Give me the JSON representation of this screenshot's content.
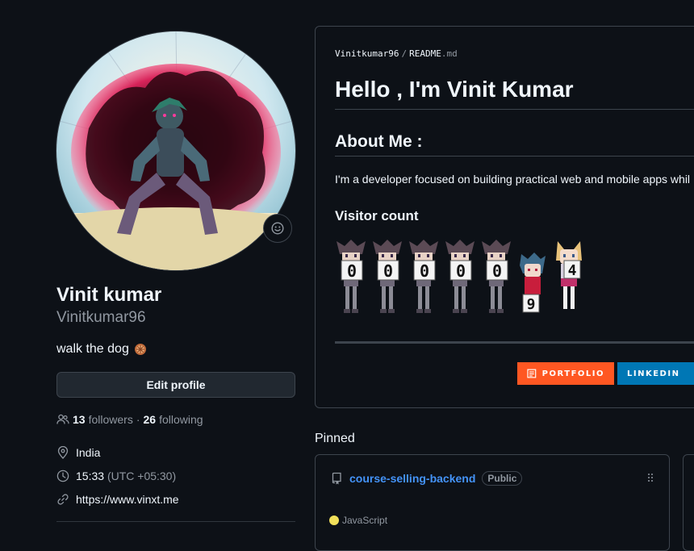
{
  "profile": {
    "display_name": "Vinit kumar",
    "username": "Vinitkumar96",
    "bio": "walk the dog",
    "edit_label": "Edit profile",
    "followers_count": "13",
    "followers_label": "followers",
    "following_count": "26",
    "following_label": "following",
    "separator": "·",
    "location": "India",
    "local_time": "15:33",
    "utc_offset": "(UTC +05:30)",
    "website": "https://www.vinxt.me"
  },
  "readme": {
    "owner": "Vinitkumar96",
    "file_base": "README",
    "file_ext": ".md",
    "heading": "Hello , I'm Vinit Kumar",
    "about_heading": "About Me :",
    "about_text": "I'm a developer focused on building practical web and mobile apps whil",
    "visitor_heading": "Visitor count",
    "visitor_digits": [
      "0",
      "0",
      "0",
      "0",
      "0",
      "9",
      "4"
    ],
    "badges": {
      "portfolio": "PORTFOLIO",
      "linkedin": "LINKEDIN"
    },
    "colors": {
      "portfolio": "#ff5722",
      "linkedin": "#0077b5"
    }
  },
  "pinned": {
    "title": "Pinned",
    "repos": [
      {
        "name": "course-selling-backend",
        "visibility": "Public",
        "language": "JavaScript",
        "language_color": "#f1e05a"
      }
    ]
  },
  "icons": {
    "status": "smiley-icon",
    "bio_emoji": "wheel-emoji",
    "followers": "people-icon",
    "location": "location-pin-icon",
    "time": "clock-icon",
    "website": "link-icon",
    "repo": "repo-icon",
    "drag": "grabber-icon"
  }
}
